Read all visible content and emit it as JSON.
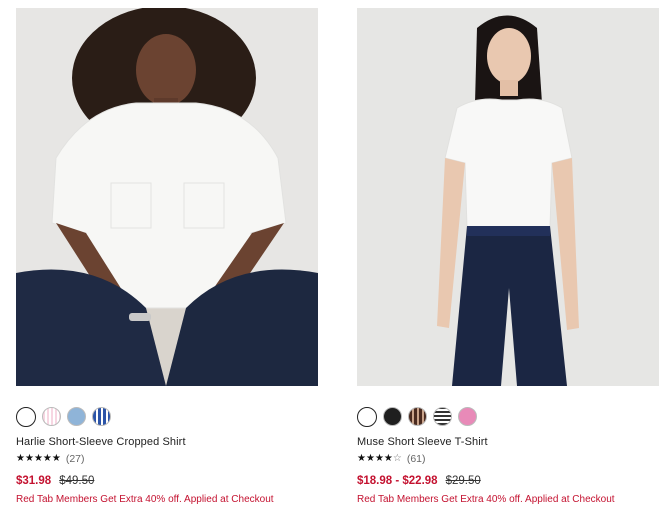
{
  "products": [
    {
      "name": "Harlie Short-Sleeve Cropped Shirt",
      "rating_count": "(27)",
      "rating_stars": 5,
      "sale_price": "$31.98",
      "original_price": "$49.50",
      "promo": "Red Tab Members Get Extra 40% off. Applied at Checkout",
      "swatches": [
        {
          "color": "#ffffff",
          "pattern": "solid",
          "selected": true
        },
        {
          "color": "#f3c6d6",
          "pattern": "stripe-pink",
          "selected": false
        },
        {
          "color": "#8fb4d8",
          "pattern": "solid-light-blue",
          "selected": false
        },
        {
          "color": "#2c54a8",
          "pattern": "stripe-blue",
          "selected": false
        }
      ]
    },
    {
      "name": "Muse Short Sleeve T-Shirt",
      "rating_count": "(61)",
      "rating_stars": 4.5,
      "sale_price": "$18.98 - $22.98",
      "original_price": "$29.50",
      "promo": "Red Tab Members Get Extra 40% off. Applied at Checkout",
      "swatches": [
        {
          "color": "#ffffff",
          "pattern": "solid",
          "selected": true
        },
        {
          "color": "#1f1f1f",
          "pattern": "solid",
          "selected": false
        },
        {
          "color": "#4a2a1f",
          "pattern": "stripe-brown",
          "selected": false
        },
        {
          "color": "#555555",
          "pattern": "stripe-black-white",
          "selected": false
        },
        {
          "color": "#e88ab8",
          "pattern": "solid-pink",
          "selected": false
        }
      ]
    }
  ],
  "colors": {
    "sale_red": "#c41230",
    "photo_bg": "#e9e8e6"
  }
}
